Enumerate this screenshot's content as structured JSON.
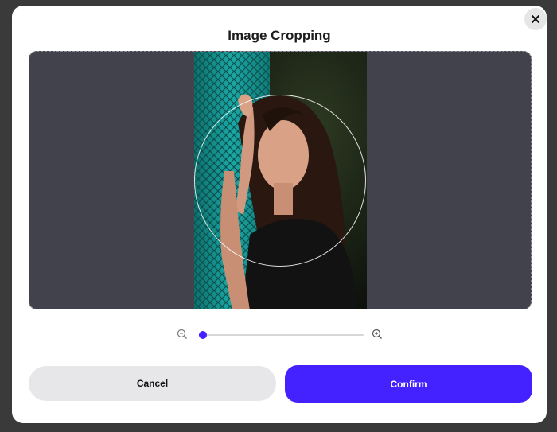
{
  "dialog": {
    "title": "Image Cropping",
    "close_icon": "close-icon",
    "cancel_label": "Cancel",
    "confirm_label": "Confirm"
  },
  "zoom": {
    "zoom_out_icon": "zoom-out-icon",
    "zoom_in_icon": "zoom-in-icon",
    "level_fraction": 0.0
  },
  "colors": {
    "accent": "#4422ff",
    "crop_background": "#42424c",
    "cancel_background": "#e7e7e9"
  },
  "photo": {
    "subject": "woman with long dark hair in black t-shirt leaning against teal chain-link fence"
  }
}
